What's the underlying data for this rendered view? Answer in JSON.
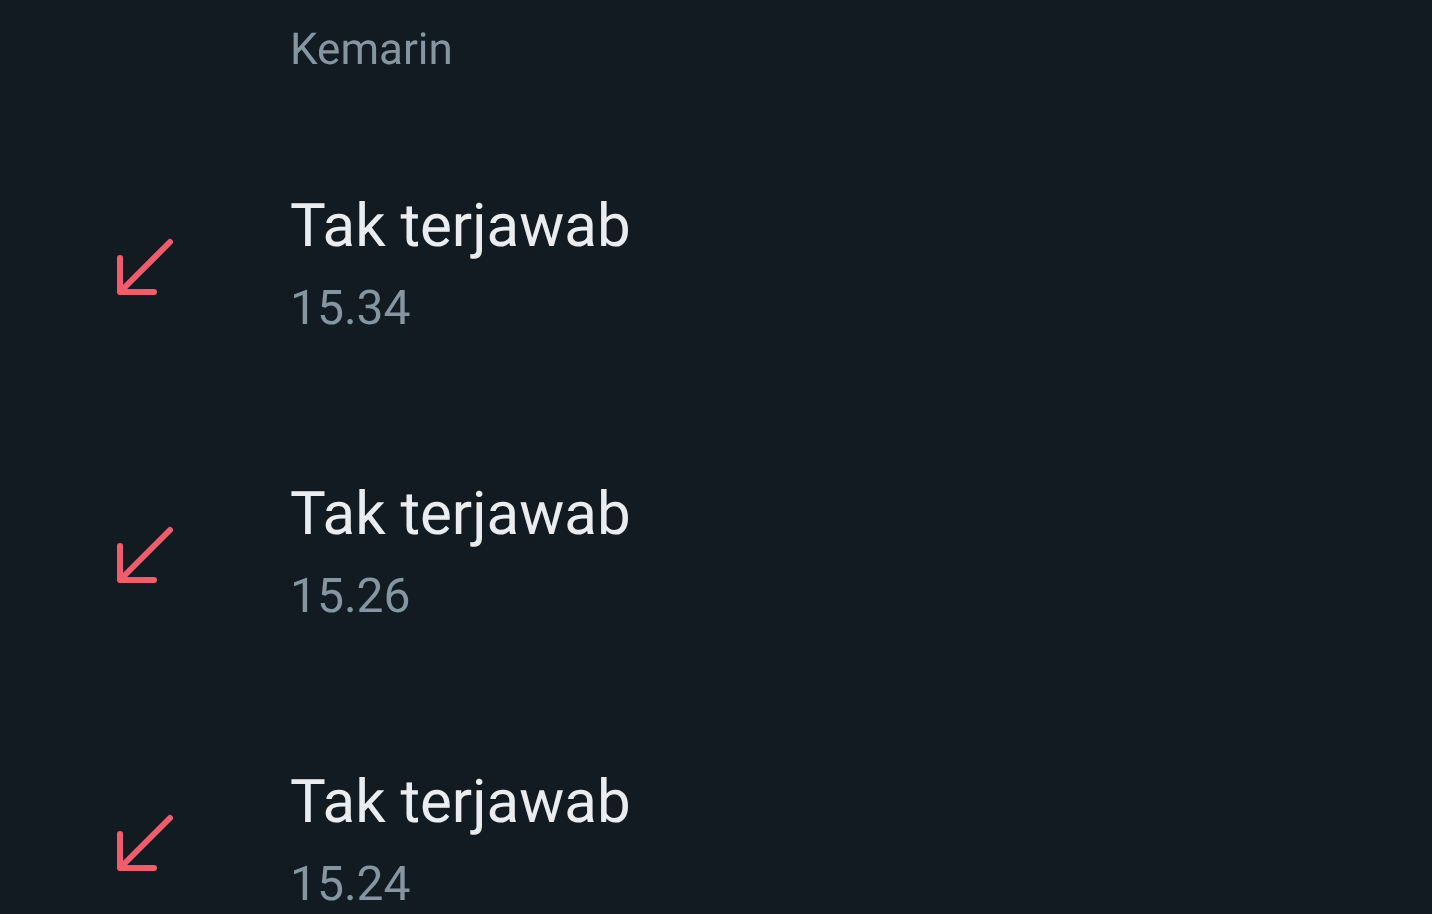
{
  "section_header": "Kemarin",
  "calls": [
    {
      "kind": "missed",
      "title": "Tak terjawab",
      "time": "15.34"
    },
    {
      "kind": "missed",
      "title": "Tak terjawab",
      "time": "15.26"
    },
    {
      "kind": "missed",
      "title": "Tak terjawab",
      "time": "15.24"
    }
  ]
}
